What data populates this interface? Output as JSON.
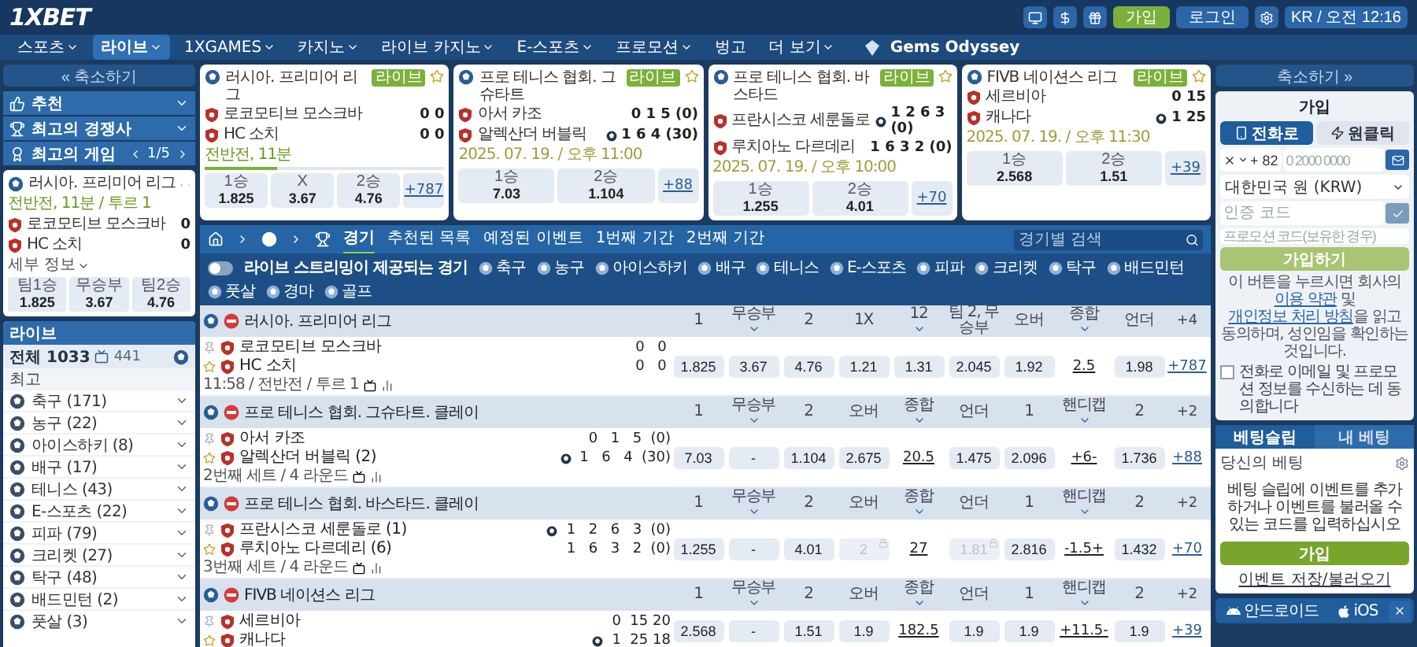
{
  "header": {
    "logo": "1XBET",
    "buttons": [
      {
        "label": "가입",
        "kind": "signup"
      },
      {
        "label": "로그인",
        "kind": "login"
      }
    ],
    "locale": "KR / 오전 12:16"
  },
  "nav": {
    "items": [
      {
        "label": "스포츠",
        "selected": false,
        "dropdown": true
      },
      {
        "label": "라이브",
        "selected": true,
        "dropdown": true
      },
      {
        "label": "1XGAMES",
        "selected": false,
        "dropdown": true
      },
      {
        "label": "카지노",
        "selected": false,
        "dropdown": true
      },
      {
        "label": "라이브 카지노",
        "selected": false,
        "dropdown": true
      },
      {
        "label": "E-스포츠",
        "selected": false,
        "dropdown": true
      },
      {
        "label": "프로모션",
        "selected": false,
        "dropdown": true
      },
      {
        "label": "벙고",
        "selected": false,
        "dropdown": false
      },
      {
        "label": "더 보기",
        "selected": false,
        "dropdown": true
      }
    ],
    "promo": "Gems Odyssey"
  },
  "left": {
    "collapse": "« 축소하기",
    "sections": [
      {
        "label": "추천",
        "kind": "recommended"
      },
      {
        "label": "최고의 경쟁사",
        "kind": "trophy"
      },
      {
        "label": "최고의 게임",
        "kind": "games",
        "pager": "1/5"
      }
    ],
    "featured": {
      "league": "러시아. 프리미어 리그",
      "status": "전반전, 11분 / 투르 1",
      "teams": [
        {
          "name": "로코모티브 모스크바",
          "score": "0"
        },
        {
          "name": "HC 소치",
          "score": "0"
        }
      ],
      "details": "세부 정보",
      "odds": [
        {
          "label": "팀1승",
          "value": "1.825"
        },
        {
          "label": "무승부",
          "value": "3.67"
        },
        {
          "label": "팀2승",
          "value": "4.76"
        }
      ]
    },
    "live": {
      "title": "라이브",
      "all": "전체 1033",
      "video_count": "441",
      "top": "최고",
      "sports": [
        "축구 (171)",
        "농구 (22)",
        "아이스하키 (8)",
        "배구 (17)",
        "테니스 (43)",
        "E-스포츠 (22)",
        "피파 (79)",
        "크리켓 (27)",
        "탁구 (48)",
        "배드민턴 (2)",
        "풋살 (3)"
      ]
    }
  },
  "cards": [
    {
      "league": "러시아. 프리미어 리그",
      "badge": "라이브",
      "teams": [
        {
          "name": "로코모티브 모스크바",
          "score": "0 0",
          "serving": false
        },
        {
          "name": "HC 소치",
          "score": "0 0",
          "serving": false
        }
      ],
      "status": "전반전, 11분",
      "level": 0.3,
      "odds": [
        {
          "label": "1승",
          "value": "1.825"
        },
        {
          "label": "X",
          "value": "3.67"
        },
        {
          "label": "2승",
          "value": "4.76"
        }
      ],
      "more": "+787"
    },
    {
      "league": "프로 테니스 협회. 그슈타트",
      "badge": "라이브",
      "teams": [
        {
          "name": "아서 카조",
          "score": "0 1 5 (0)",
          "serving": false
        },
        {
          "name": "알렉산더 버블릭",
          "score": "1 6 4 (30)",
          "serving": true
        }
      ],
      "date": "2025. 07. 19. / 오후 11:00",
      "odds": [
        {
          "label": "1승",
          "value": "7.03"
        },
        {
          "label": "2승",
          "value": "1.104"
        }
      ],
      "more": "+88"
    },
    {
      "league": "프로 테니스 협회. 바스타드",
      "badge": "라이브",
      "teams": [
        {
          "name": "프란시스코 세룬돌로",
          "score": "1 2 6 3 (0)",
          "serving": true
        },
        {
          "name": "루치아노 다르데리",
          "score": "1 6 3 2 (0)",
          "serving": false
        }
      ],
      "date": "2025. 07. 19. / 오후 10:00",
      "odds": [
        {
          "label": "1승",
          "value": "1.255"
        },
        {
          "label": "2승",
          "value": "4.01"
        }
      ],
      "more": "+70"
    },
    {
      "league": "FIVB 네이션스 리그",
      "badge": "라이브",
      "teams": [
        {
          "name": "세르비아",
          "score": "0 15",
          "serving": false
        },
        {
          "name": "캐나다",
          "score": "1 25",
          "serving": true
        }
      ],
      "date": "2025. 07. 19. / 오후 11:30",
      "odds": [
        {
          "label": "1승",
          "value": "2.568"
        },
        {
          "label": "2승",
          "value": "1.51"
        }
      ],
      "more": "+39"
    }
  ],
  "table": {
    "tabs": [
      {
        "label": "경기",
        "selected": true
      },
      {
        "label": "추천된 목록",
        "selected": false
      },
      {
        "label": "예정된 이벤트",
        "selected": false
      },
      {
        "label": "1번째 기간",
        "selected": false
      },
      {
        "label": "2번째 기간",
        "selected": false
      }
    ],
    "search_placeholder": "경기별 검색",
    "stream_filter": {
      "label": "라이브 스트리밍이 제공되는 경기",
      "on": false
    },
    "sports": [
      "축구",
      "농구",
      "아이스하키",
      "배구",
      "테니스",
      "E-스포츠",
      "피파",
      "크리켓",
      "탁구",
      "배드민턴",
      "풋살",
      "경마",
      "골프"
    ],
    "groups": [
      {
        "league": "러시아. 프리미어 리그",
        "columns": [
          {
            "label": "1",
            "dropdown": false
          },
          {
            "label": "무승부",
            "dropdown": true
          },
          {
            "label": "2",
            "dropdown": false
          },
          {
            "label": "1X",
            "dropdown": false
          },
          {
            "label": "12",
            "dropdown": true
          },
          {
            "label": "팀 2, 무승부",
            "dropdown": false
          },
          {
            "label": "오버",
            "dropdown": false
          },
          {
            "label": "종합",
            "dropdown": true
          },
          {
            "label": "언더",
            "dropdown": false
          }
        ],
        "extra": "+4",
        "match": {
          "teams": [
            {
              "name": "로코모티브 모스크바",
              "scores": [
                "0",
                "0"
              ],
              "serving": false
            },
            {
              "name": "HC 소치",
              "scores": [
                "0",
                "0"
              ],
              "serving": false
            }
          ],
          "info": "11:58 / 전반전 / 투르 1",
          "odds": [
            {
              "value": "1.825",
              "kind": "odd"
            },
            {
              "value": "3.67",
              "kind": "odd"
            },
            {
              "value": "4.76",
              "kind": "odd"
            },
            {
              "value": "1.21",
              "kind": "odd"
            },
            {
              "value": "1.31",
              "kind": "odd"
            },
            {
              "value": "2.045",
              "kind": "odd"
            },
            {
              "value": "1.92",
              "kind": "odd"
            },
            {
              "value": "2.5",
              "kind": "line"
            },
            {
              "value": "1.98",
              "kind": "odd"
            }
          ],
          "more": "+787"
        }
      },
      {
        "league": "프로 테니스 협회. 그슈타트. 클레이",
        "columns": [
          {
            "label": "1",
            "dropdown": false
          },
          {
            "label": "무승부",
            "dropdown": true
          },
          {
            "label": "2",
            "dropdown": false
          },
          {
            "label": "오버",
            "dropdown": false
          },
          {
            "label": "종합",
            "dropdown": true
          },
          {
            "label": "언더",
            "dropdown": false
          },
          {
            "label": "1",
            "dropdown": false
          },
          {
            "label": "핸디캡",
            "dropdown": true
          },
          {
            "label": "2",
            "dropdown": false
          }
        ],
        "extra": "+2",
        "match": {
          "teams": [
            {
              "name": "아서 카조",
              "scores": [
                "0",
                "1",
                "5",
                "(0)"
              ],
              "serving": false
            },
            {
              "name": "알렉산더 버블릭 (2)",
              "scores": [
                "1",
                "6",
                "4",
                "(30)"
              ],
              "serving": true
            }
          ],
          "info": "2번째 세트 / 4 라운드",
          "odds": [
            {
              "value": "7.03",
              "kind": "odd"
            },
            {
              "value": "-",
              "kind": "odd"
            },
            {
              "value": "1.104",
              "kind": "odd"
            },
            {
              "value": "2.675",
              "kind": "odd"
            },
            {
              "value": "20.5",
              "kind": "line"
            },
            {
              "value": "1.475",
              "kind": "odd"
            },
            {
              "value": "2.096",
              "kind": "odd"
            },
            {
              "value": "+6-",
              "kind": "line"
            },
            {
              "value": "1.736",
              "kind": "odd"
            }
          ],
          "more": "+88"
        }
      },
      {
        "league": "프로 테니스 협회. 바스타드. 클레이",
        "columns": [
          {
            "label": "1",
            "dropdown": false
          },
          {
            "label": "무승부",
            "dropdown": true
          },
          {
            "label": "2",
            "dropdown": false
          },
          {
            "label": "오버",
            "dropdown": false
          },
          {
            "label": "종합",
            "dropdown": true
          },
          {
            "label": "언더",
            "dropdown": false
          },
          {
            "label": "1",
            "dropdown": false
          },
          {
            "label": "핸디캡",
            "dropdown": true
          },
          {
            "label": "2",
            "dropdown": false
          }
        ],
        "extra": "+2",
        "match": {
          "teams": [
            {
              "name": "프란시스코 세룬돌로 (1)",
              "scores": [
                "1",
                "2",
                "6",
                "3",
                "(0)"
              ],
              "serving": true
            },
            {
              "name": "루치아노 다르데리 (6)",
              "scores": [
                "1",
                "6",
                "3",
                "2",
                "(0)"
              ],
              "serving": false
            }
          ],
          "info": "3번째 세트 / 4 라운드",
          "odds": [
            {
              "value": "1.255",
              "kind": "odd"
            },
            {
              "value": "-",
              "kind": "odd"
            },
            {
              "value": "4.01",
              "kind": "odd"
            },
            {
              "value": "2",
              "kind": "locked"
            },
            {
              "value": "27",
              "kind": "line"
            },
            {
              "value": "1.81",
              "kind": "locked"
            },
            {
              "value": "2.816",
              "kind": "odd"
            },
            {
              "value": "-1.5+",
              "kind": "line"
            },
            {
              "value": "1.432",
              "kind": "odd"
            }
          ],
          "more": "+70"
        }
      },
      {
        "league": "FIVB 네이션스 리그",
        "columns": [
          {
            "label": "1",
            "dropdown": false
          },
          {
            "label": "무승부",
            "dropdown": true
          },
          {
            "label": "2",
            "dropdown": false
          },
          {
            "label": "오버",
            "dropdown": false
          },
          {
            "label": "종합",
            "dropdown": true
          },
          {
            "label": "언더",
            "dropdown": false
          },
          {
            "label": "1",
            "dropdown": false
          },
          {
            "label": "핸디캡",
            "dropdown": true
          },
          {
            "label": "2",
            "dropdown": false
          }
        ],
        "extra": "+2",
        "match": {
          "teams": [
            {
              "name": "세르비아",
              "scores": [
                "0",
                "15",
                "20"
              ],
              "serving": false
            },
            {
              "name": "캐나다",
              "scores": [
                "1",
                "25",
                "18"
              ],
              "serving": true
            }
          ],
          "odds": [
            {
              "value": "2.568",
              "kind": "odd"
            },
            {
              "value": "-",
              "kind": "odd"
            },
            {
              "value": "1.51",
              "kind": "odd"
            },
            {
              "value": "1.9",
              "kind": "odd"
            },
            {
              "value": "182.5",
              "kind": "line"
            },
            {
              "value": "1.9",
              "kind": "odd"
            },
            {
              "value": "1.9",
              "kind": "odd"
            },
            {
              "value": "+11.5-",
              "kind": "line"
            },
            {
              "value": "1.9",
              "kind": "odd"
            }
          ],
          "more": "+39"
        }
      }
    ]
  },
  "right": {
    "collapse": "축소하기 »",
    "signup": {
      "title": "가입",
      "tabs": [
        {
          "label": "전화로",
          "kind": "phone",
          "selected": true
        },
        {
          "label": "원클릭",
          "kind": "oneclick",
          "selected": false
        }
      ],
      "phone_code": "+ 82",
      "phone_placeholder": "0 2000 0000",
      "currency": "대한민국 원 (KRW)",
      "code_placeholder": "인증 코드",
      "promo_placeholder": "프로모션 코드(보유한 경우)",
      "submit": "가입하기",
      "terms": [
        {
          "text": "이 버튼을 누르시면 회사의 ",
          "link": false
        },
        {
          "text": "이용 약관",
          "link": true
        },
        {
          "text": " 및 ",
          "link": false
        },
        {
          "text": "개인정보 처리 방침",
          "link": true
        },
        {
          "text": "을 읽고 동의하며, 성인임을 확인하는 것입니다.",
          "link": false
        }
      ],
      "consent": {
        "label": "전화로 이메일 및 프로모션 정보를 수신하는 데 동의합니다",
        "checked": false
      }
    },
    "betslip": {
      "tabs": [
        {
          "label": "베팅슬립",
          "selected": true
        },
        {
          "label": "내 베팅",
          "selected": false
        }
      ],
      "heading": "당신의 베팅",
      "message": "베팅 슬립에 이벤트를 추가하거나 이벤트를 불러올 수 있는 코드를 입력하십시오",
      "button": "가입",
      "link": "이벤트 저장/불러오기"
    },
    "apps": [
      {
        "label": "안드로이드",
        "kind": "android"
      },
      {
        "label": "iOS",
        "kind": "ios"
      }
    ]
  }
}
